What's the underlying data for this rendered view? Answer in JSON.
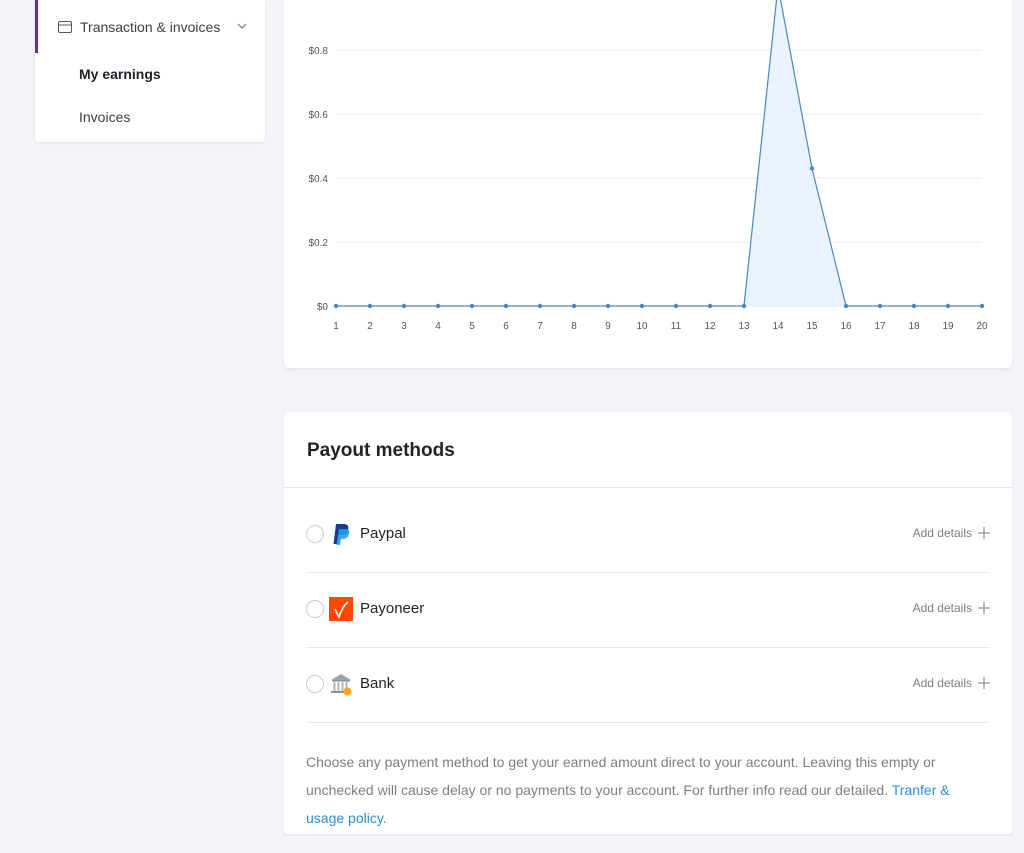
{
  "sidebar": {
    "group_label": "Transaction & invoices",
    "items": [
      {
        "label": "My earnings"
      },
      {
        "label": "Invoices"
      }
    ]
  },
  "chart_data": {
    "type": "area",
    "x": [
      1,
      2,
      3,
      4,
      5,
      6,
      7,
      8,
      9,
      10,
      11,
      12,
      13,
      14,
      15,
      16,
      17,
      18,
      19,
      20
    ],
    "y": [
      0,
      0,
      0,
      0,
      0,
      0,
      0,
      0,
      0,
      0,
      0,
      0,
      0,
      1.0,
      0.43,
      0,
      0,
      0,
      0,
      0
    ],
    "y_ticks": [
      "$0",
      "$0.2",
      "$0.4",
      "$0.6",
      "$0.8"
    ],
    "y_tick_values": [
      0,
      0.2,
      0.4,
      0.6,
      0.8
    ],
    "line_color": "#4a86c5",
    "fill_color": "#eaf2fb",
    "grid": true
  },
  "payout": {
    "title": "Payout methods",
    "methods": [
      {
        "name": "Paypal",
        "icon": "paypal-icon",
        "action": "Add details"
      },
      {
        "name": "Payoneer",
        "icon": "payoneer-icon",
        "action": "Add details"
      },
      {
        "name": "Bank",
        "icon": "bank-icon",
        "action": "Add details"
      }
    ],
    "policy_text": "Choose any payment method to get your earned amount direct to your account. Leaving this empty or unchecked will cause delay or no payments to your account. For further info read our detailed. ",
    "policy_link": "Tranfer & usage policy."
  },
  "colors": {
    "accent": "#6b2c8f",
    "link": "#2a8fd8",
    "chart_line": "#4a86c5"
  }
}
